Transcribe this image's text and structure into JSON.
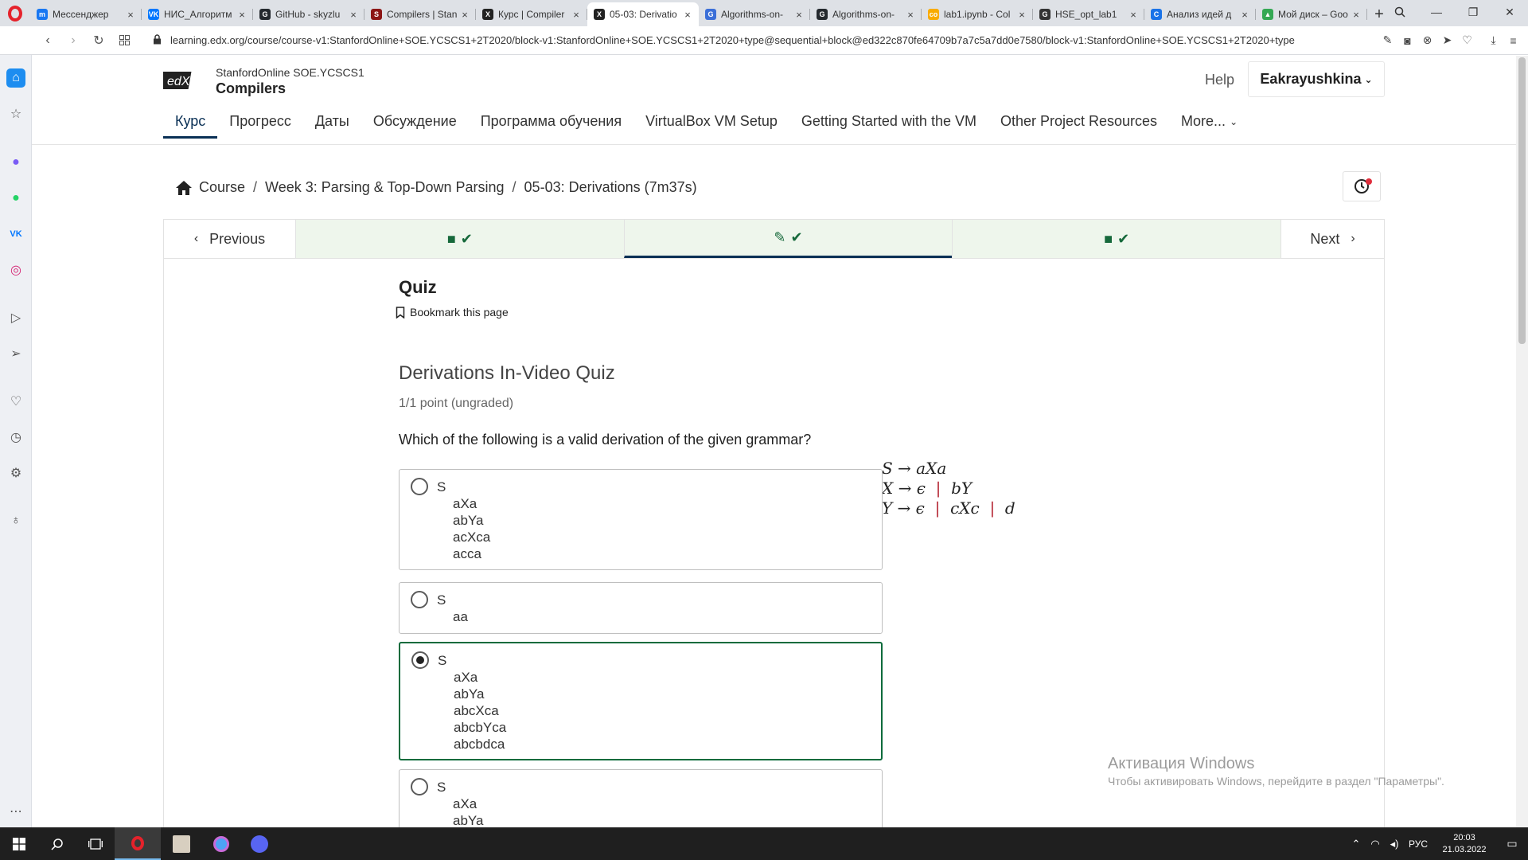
{
  "browser": {
    "tabs": [
      {
        "title": "Мессенджер",
        "fav_color": "#1877f2",
        "fav_glyph": "m",
        "active": false
      },
      {
        "title": "НИС_Алгоритм",
        "fav_color": "#0077ff",
        "fav_glyph": "VK",
        "active": false
      },
      {
        "title": "GitHub - skyzlu",
        "fav_color": "#24292e",
        "fav_glyph": "G",
        "active": false
      },
      {
        "title": "Compilers | Stan",
        "fav_color": "#8c1515",
        "fav_glyph": "S",
        "active": false
      },
      {
        "title": "Курс | Compiler",
        "fav_color": "#222222",
        "fav_glyph": "X",
        "active": false
      },
      {
        "title": "05-03: Derivatio",
        "fav_color": "#222222",
        "fav_glyph": "X",
        "active": true
      },
      {
        "title": "Algorithms-on-",
        "fav_color": "#3b6fd8",
        "fav_glyph": "G",
        "active": false
      },
      {
        "title": "Algorithms-on-",
        "fav_color": "#24292e",
        "fav_glyph": "G",
        "active": false
      },
      {
        "title": "lab1.ipynb - Col",
        "fav_color": "#f9ab00",
        "fav_glyph": "co",
        "active": false
      },
      {
        "title": "HSE_opt_lab1",
        "fav_color": "#333333",
        "fav_glyph": "G",
        "active": false
      },
      {
        "title": "Анализ идей д",
        "fav_color": "#1a73e8",
        "fav_glyph": "C",
        "active": false
      },
      {
        "title": "Мой диск – Goo",
        "fav_color": "#34a853",
        "fav_glyph": "▲",
        "active": false
      }
    ],
    "url": "learning.edx.org/course/course-v1:StanfordOnline+SOE.YCSCS1+2T2020/block-v1:StanfordOnline+SOE.YCSCS1+2T2020+type@sequential+block@ed322c870fe64709b7a7c5a7dd0e7580/block-v1:StanfordOnline+SOE.YCSCS1+2T2020+type"
  },
  "header": {
    "logo_text": "edX",
    "course_org": "StanfordOnline SOE.YCSCS1",
    "course_title": "Compilers",
    "help": "Help",
    "user": "Eakrayushkina"
  },
  "course_nav": [
    "Курс",
    "Прогресс",
    "Даты",
    "Обсуждение",
    "Программа обучения",
    "VirtualBox VM Setup",
    "Getting Started with the VM",
    "Other Project Resources",
    "More..."
  ],
  "breadcrumb": {
    "home": "Course",
    "week": "Week 3: Parsing & Top-Down Parsing",
    "unit": "05-03: Derivations (7m37s)",
    "sep": "/"
  },
  "sequence": {
    "previous": "Previous",
    "next": "Next"
  },
  "quiz": {
    "title": "Quiz",
    "bookmark": "Bookmark this page",
    "problem_title": "Derivations In-Video Quiz",
    "points": "1/1 point (ungraded)",
    "question": "Which of the following is a valid derivation of the given grammar?"
  },
  "grammar": {
    "rule_s": "S → aXa",
    "rule_x_a": "X → ϵ",
    "rule_x_b": "bY",
    "rule_y_a": "Y → ϵ",
    "rule_y_b": "cXc",
    "rule_y_c": "d",
    "bar": "|"
  },
  "options": [
    {
      "start": "S",
      "steps": [
        "aXa",
        "abYa",
        "acXca",
        "acca"
      ],
      "selected": false
    },
    {
      "start": "S",
      "steps": [
        "aa"
      ],
      "selected": false
    },
    {
      "start": "S",
      "steps": [
        "aXa",
        "abYa",
        "abcXca",
        "abcbYca",
        "abcbdca"
      ],
      "selected": true
    },
    {
      "start": "S",
      "steps": [
        "aXa",
        "abYa"
      ],
      "selected": false
    }
  ],
  "watermark": {
    "title": "Активация Windows",
    "subtitle": "Чтобы активировать Windows, перейдите в раздел \"Параметры\"."
  },
  "taskbar": {
    "lang": "РУС",
    "time": "20:03",
    "date": "21.03.2022"
  },
  "colors": {
    "accent_green": "#0d6b3c",
    "nav_active": "#0a3055",
    "unit_complete_bg": "#eef6ec"
  }
}
